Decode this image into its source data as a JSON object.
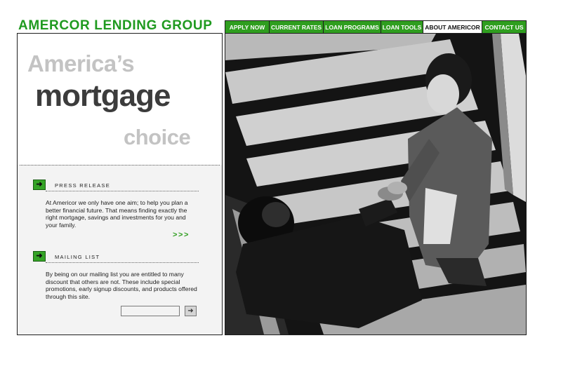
{
  "brand": {
    "name": "AMERCOR LENDING GROUP"
  },
  "nav": {
    "items": [
      {
        "label": "APPLY NOW"
      },
      {
        "label": "CURRENT RATES"
      },
      {
        "label": "LOAN PROGRAMS"
      },
      {
        "label": "LOAN TOOLS"
      },
      {
        "label": "ABOUT AMERICOR"
      },
      {
        "label": "CONTACT US"
      }
    ],
    "active": "ABOUT AMERICOR"
  },
  "hero": {
    "line1": "America’s",
    "line2": "mortgage",
    "line3": "choice"
  },
  "press_release": {
    "heading": "PRESS RELEASE",
    "body": "At Americor we only have one aim; to help you plan a better financial future. That means finding exactly the right mortgage, savings and investments for you and your family.",
    "more_label": ">>>"
  },
  "mailing_list": {
    "heading": "MAILING LIST",
    "body": "By being on our mailing list you are entitled to many discount that others are not. These include special promotions, early signup discounts, and products offered through this site.",
    "email_value": "",
    "email_placeholder": ""
  },
  "colors": {
    "brand_green": "#2f9e1f",
    "text_gray": "#3c3c3c",
    "light_gray": "#c3c3c3"
  },
  "icons": {
    "section_arrow": "arrow-right-icon",
    "submit_arrow": "arrow-right-icon"
  }
}
